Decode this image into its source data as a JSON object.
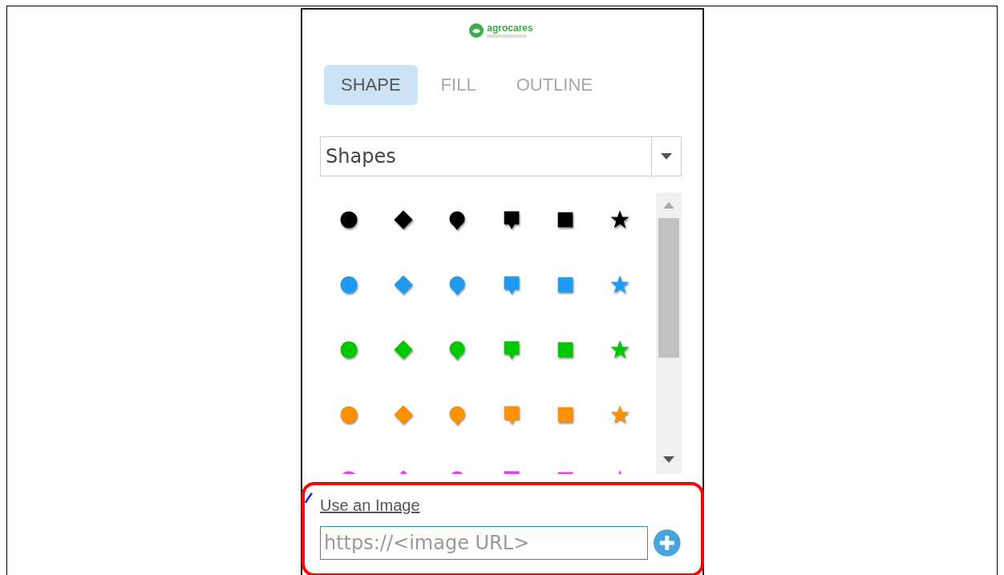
{
  "logo": {
    "name": "agrocares"
  },
  "tabs": [
    {
      "label": "SHAPE",
      "selected": true
    },
    {
      "label": "FILL",
      "selected": false
    },
    {
      "label": "OUTLINE",
      "selected": false
    }
  ],
  "category_dropdown": {
    "value": "Shapes"
  },
  "shape_kinds": [
    {
      "kind": "circle"
    },
    {
      "kind": "diamond"
    },
    {
      "kind": "pin"
    },
    {
      "kind": "callout"
    },
    {
      "kind": "square"
    },
    {
      "kind": "star"
    }
  ],
  "symbol_rows": [
    {
      "color": "#000000"
    },
    {
      "color": "#1e9bf0"
    },
    {
      "color": "#00c800"
    },
    {
      "color": "#ff9000"
    },
    {
      "color": "#e040f0"
    }
  ],
  "image_section": {
    "link": "Use an Image",
    "url_field": {
      "placeholder": "https://<image URL>"
    }
  }
}
